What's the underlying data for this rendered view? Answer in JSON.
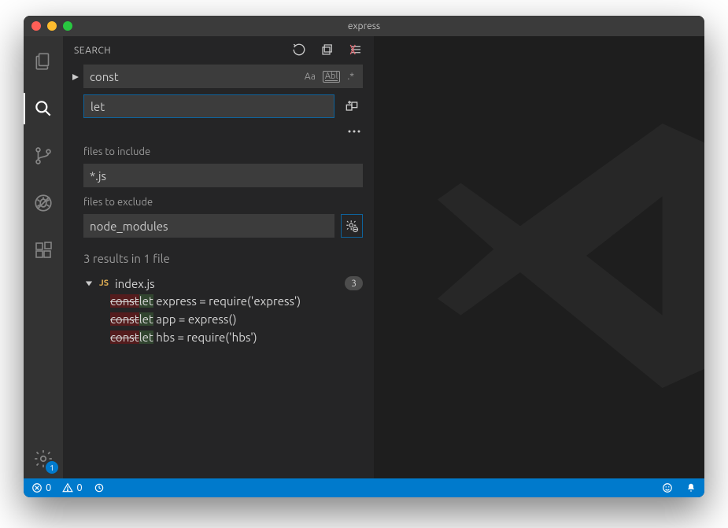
{
  "window": {
    "title": "express"
  },
  "activitybar": {
    "settings_badge": "1"
  },
  "sidebar": {
    "title": "SEARCH",
    "search_value": "const",
    "replace_value": "let",
    "include_label": "files to include",
    "include_value": "*.js",
    "exclude_label": "files to exclude",
    "exclude_value": "node_modules",
    "summary": "3 results in 1 file",
    "file": {
      "lang": "JS",
      "name": "index.js",
      "count": "3"
    },
    "hits": [
      {
        "del": "const",
        "ins": "let",
        "rest": " express = require('express')"
      },
      {
        "del": "const",
        "ins": "let",
        "rest": " app = express()"
      },
      {
        "del": "const",
        "ins": "let",
        "rest": " hbs = require('hbs')"
      }
    ],
    "opts": {
      "case": "Aa",
      "word": "Abl",
      "regex": ".*"
    }
  },
  "status": {
    "errors": "0",
    "warnings": "0"
  }
}
